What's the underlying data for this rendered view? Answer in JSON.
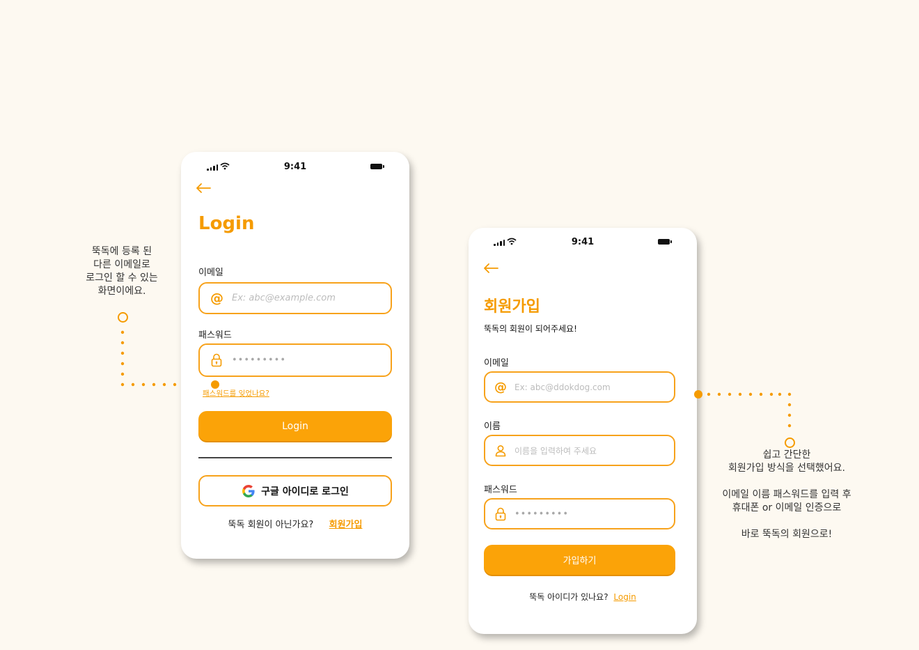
{
  "colors": {
    "accent": "#f59b00",
    "background": "#fdf9f1"
  },
  "annotation_left": {
    "text": "뚝독에 등록 된\n다른 이메일로\n로그인 할 수 있는\n화면이에요."
  },
  "annotation_right": {
    "text": "쉽고 간단한\n회원가입 방식을 선택했어요.\n\n이메일 이름 패스워드를 입력 후\n휴대폰 or 이메일 인증으로\n\n바로 뚝독의 회원으로!"
  },
  "login": {
    "status_time": "9:41",
    "back_icon": "arrow-left-icon",
    "title": "Login",
    "email_label": "이메일",
    "email_placeholder": "Ex: abc@example.com",
    "password_label": "패스워드",
    "password_value": "•••••••••",
    "forgot_link": "패스워드를 잊었나요?",
    "login_button": "Login",
    "google_button": "구글 아이디로 로그인",
    "signup_prompt": "뚝독 회원이 아닌가요?",
    "signup_link": "회원가입"
  },
  "signup": {
    "status_time": "9:41",
    "back_icon": "arrow-left-icon",
    "title": "회원가입",
    "subtitle": "뚝독의 회원이 되어주세요!",
    "email_label": "이메일",
    "email_placeholder": "Ex: abc@ddokdog.com",
    "name_label": "이름",
    "name_placeholder": "이름을 입력하여 주세요",
    "password_label": "패스워드",
    "password_value": "•••••••••",
    "submit_button": "가입하기",
    "login_prompt": "뚝독 아이디가 있나요?",
    "login_link": "Login"
  }
}
